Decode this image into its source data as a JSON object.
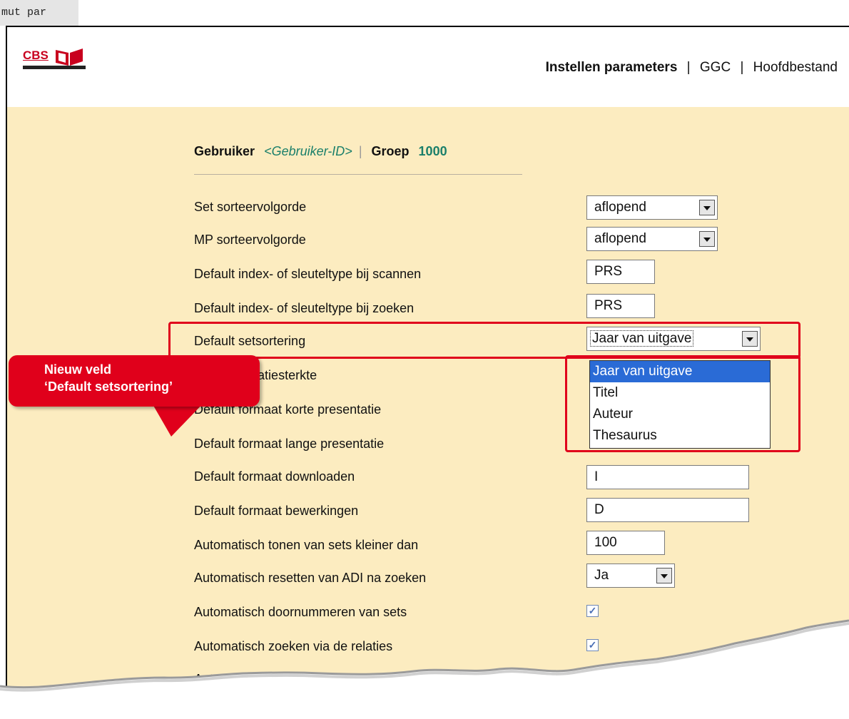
{
  "command_bar": {
    "text": "mut par"
  },
  "logo": {
    "text": "CBS"
  },
  "nav": {
    "active": "Instellen parameters",
    "items": [
      "GGC",
      "Hoofdbestand"
    ],
    "separator": "|"
  },
  "user": {
    "gebruiker_label": "Gebruiker",
    "gebruiker_id": "<Gebruiker-ID>",
    "groep_label": "Groep",
    "groep_value": "1000"
  },
  "settings": [
    {
      "label": "Set sorteervolgorde",
      "value": "aflopend",
      "kind": "select"
    },
    {
      "label": "MP sorteervolgorde",
      "value": "aflopend",
      "kind": "select"
    },
    {
      "label": "Default index- of sleuteltype bij scannen",
      "value": "PRS",
      "kind": "input"
    },
    {
      "label": "Default index- of sleuteltype bij zoeken",
      "value": "PRS",
      "kind": "input"
    },
    {
      "label": "Default setsortering",
      "value": "Jaar van uitgave",
      "kind": "select"
    },
    {
      "label": "Default collatiesterkte",
      "value": "",
      "kind": "select"
    },
    {
      "label": "Default formaat korte presentatie",
      "value": "",
      "kind": "input"
    },
    {
      "label": "Default formaat lange presentatie",
      "value": "",
      "kind": "input"
    },
    {
      "label": "Default formaat downloaden",
      "value": "I",
      "kind": "input"
    },
    {
      "label": "Default formaat bewerkingen",
      "value": "D",
      "kind": "input"
    },
    {
      "label": "Automatisch tonen van sets kleiner dan",
      "value": "100",
      "kind": "input"
    },
    {
      "label": "Automatisch resetten van ADI na zoeken",
      "value": "Ja",
      "kind": "select"
    },
    {
      "label": "Automatisch doornummeren van sets",
      "checked": true,
      "kind": "checkbox"
    },
    {
      "label": "Automatisch zoeken via de relaties",
      "checked": true,
      "kind": "checkbox"
    },
    {
      "label": "Automatisch sorteren van de l",
      "kind": "text"
    }
  ],
  "setsortering_options": [
    "Jaar van uitgave",
    "Titel",
    "Auteur",
    "Thesaurus"
  ],
  "callout": {
    "line1": "Nieuw veld",
    "line2": "‘Default setsortering’"
  },
  "colors": {
    "content_bg": "#fcecc0",
    "accent_red": "#e0001b",
    "teal": "#1a7f6a",
    "highlight": "#2a6bd6"
  }
}
